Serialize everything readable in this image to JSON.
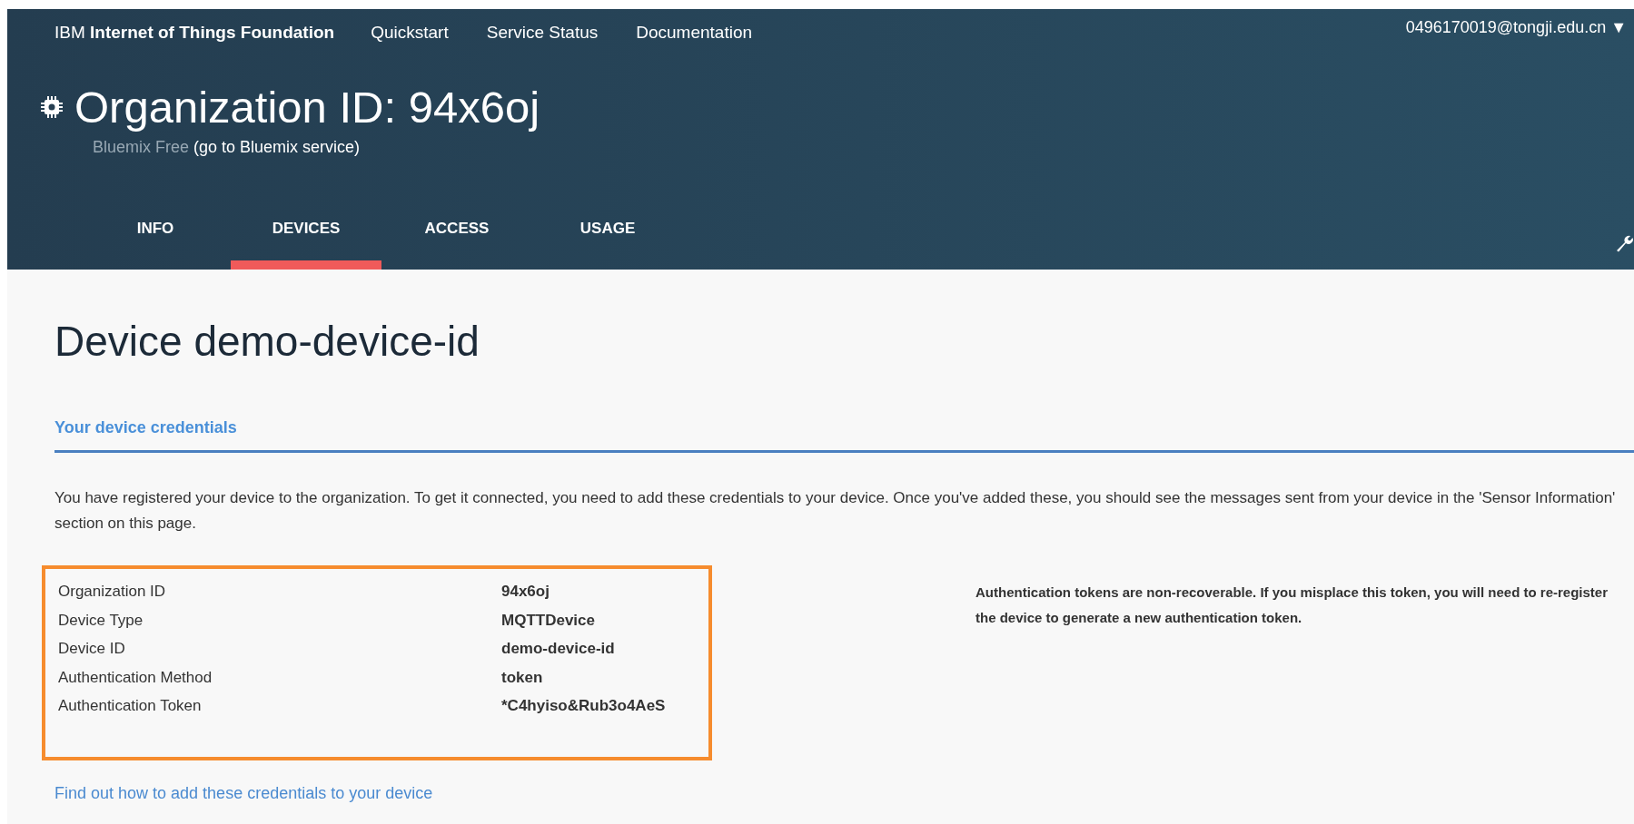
{
  "top_nav": {
    "brand": "IBM **Internet of Things Foundation**",
    "links": [
      "Quickstart",
      "Service Status",
      "Documentation"
    ],
    "user": "0496170019@tongji.edu.cn",
    "user_caret": "▼"
  },
  "organization": {
    "title": "Organization ID: 94x6oj",
    "plan": "Bluemix Free",
    "service_link": "(go to Bluemix service)"
  },
  "tabs": [
    {
      "label": "INFO",
      "selected": false
    },
    {
      "label": "DEVICES",
      "selected": true
    },
    {
      "label": "ACCESS",
      "selected": false
    },
    {
      "label": "USAGE",
      "selected": false
    }
  ],
  "page_title": "Device demo-device-id",
  "section": {
    "title": "Your device credentials",
    "intro": "You have registered your device to the organization. To get it connected, you need to add these credentials to your device. Once you've added these, you should see the messages sent from your device in the 'Sensor Information' section on this page.",
    "credentials_highlighted": true,
    "credentials": [
      {
        "label": "Organization ID",
        "value": "94x6oj"
      },
      {
        "label": "Device Type",
        "value": "MQTTDevice"
      },
      {
        "label": "Device ID",
        "value": "demo-device-id"
      },
      {
        "label": "Authentication Method",
        "value": "token"
      },
      {
        "label": "Authentication Token",
        "value": "*C4hyiso&Rub3o4AeS"
      }
    ],
    "note": "Authentication tokens are non-recoverable. If you misplace this token, you will need to re-register the device to generate a new authentication token.",
    "help_link": "Find out how to add these credentials to your device"
  }
}
